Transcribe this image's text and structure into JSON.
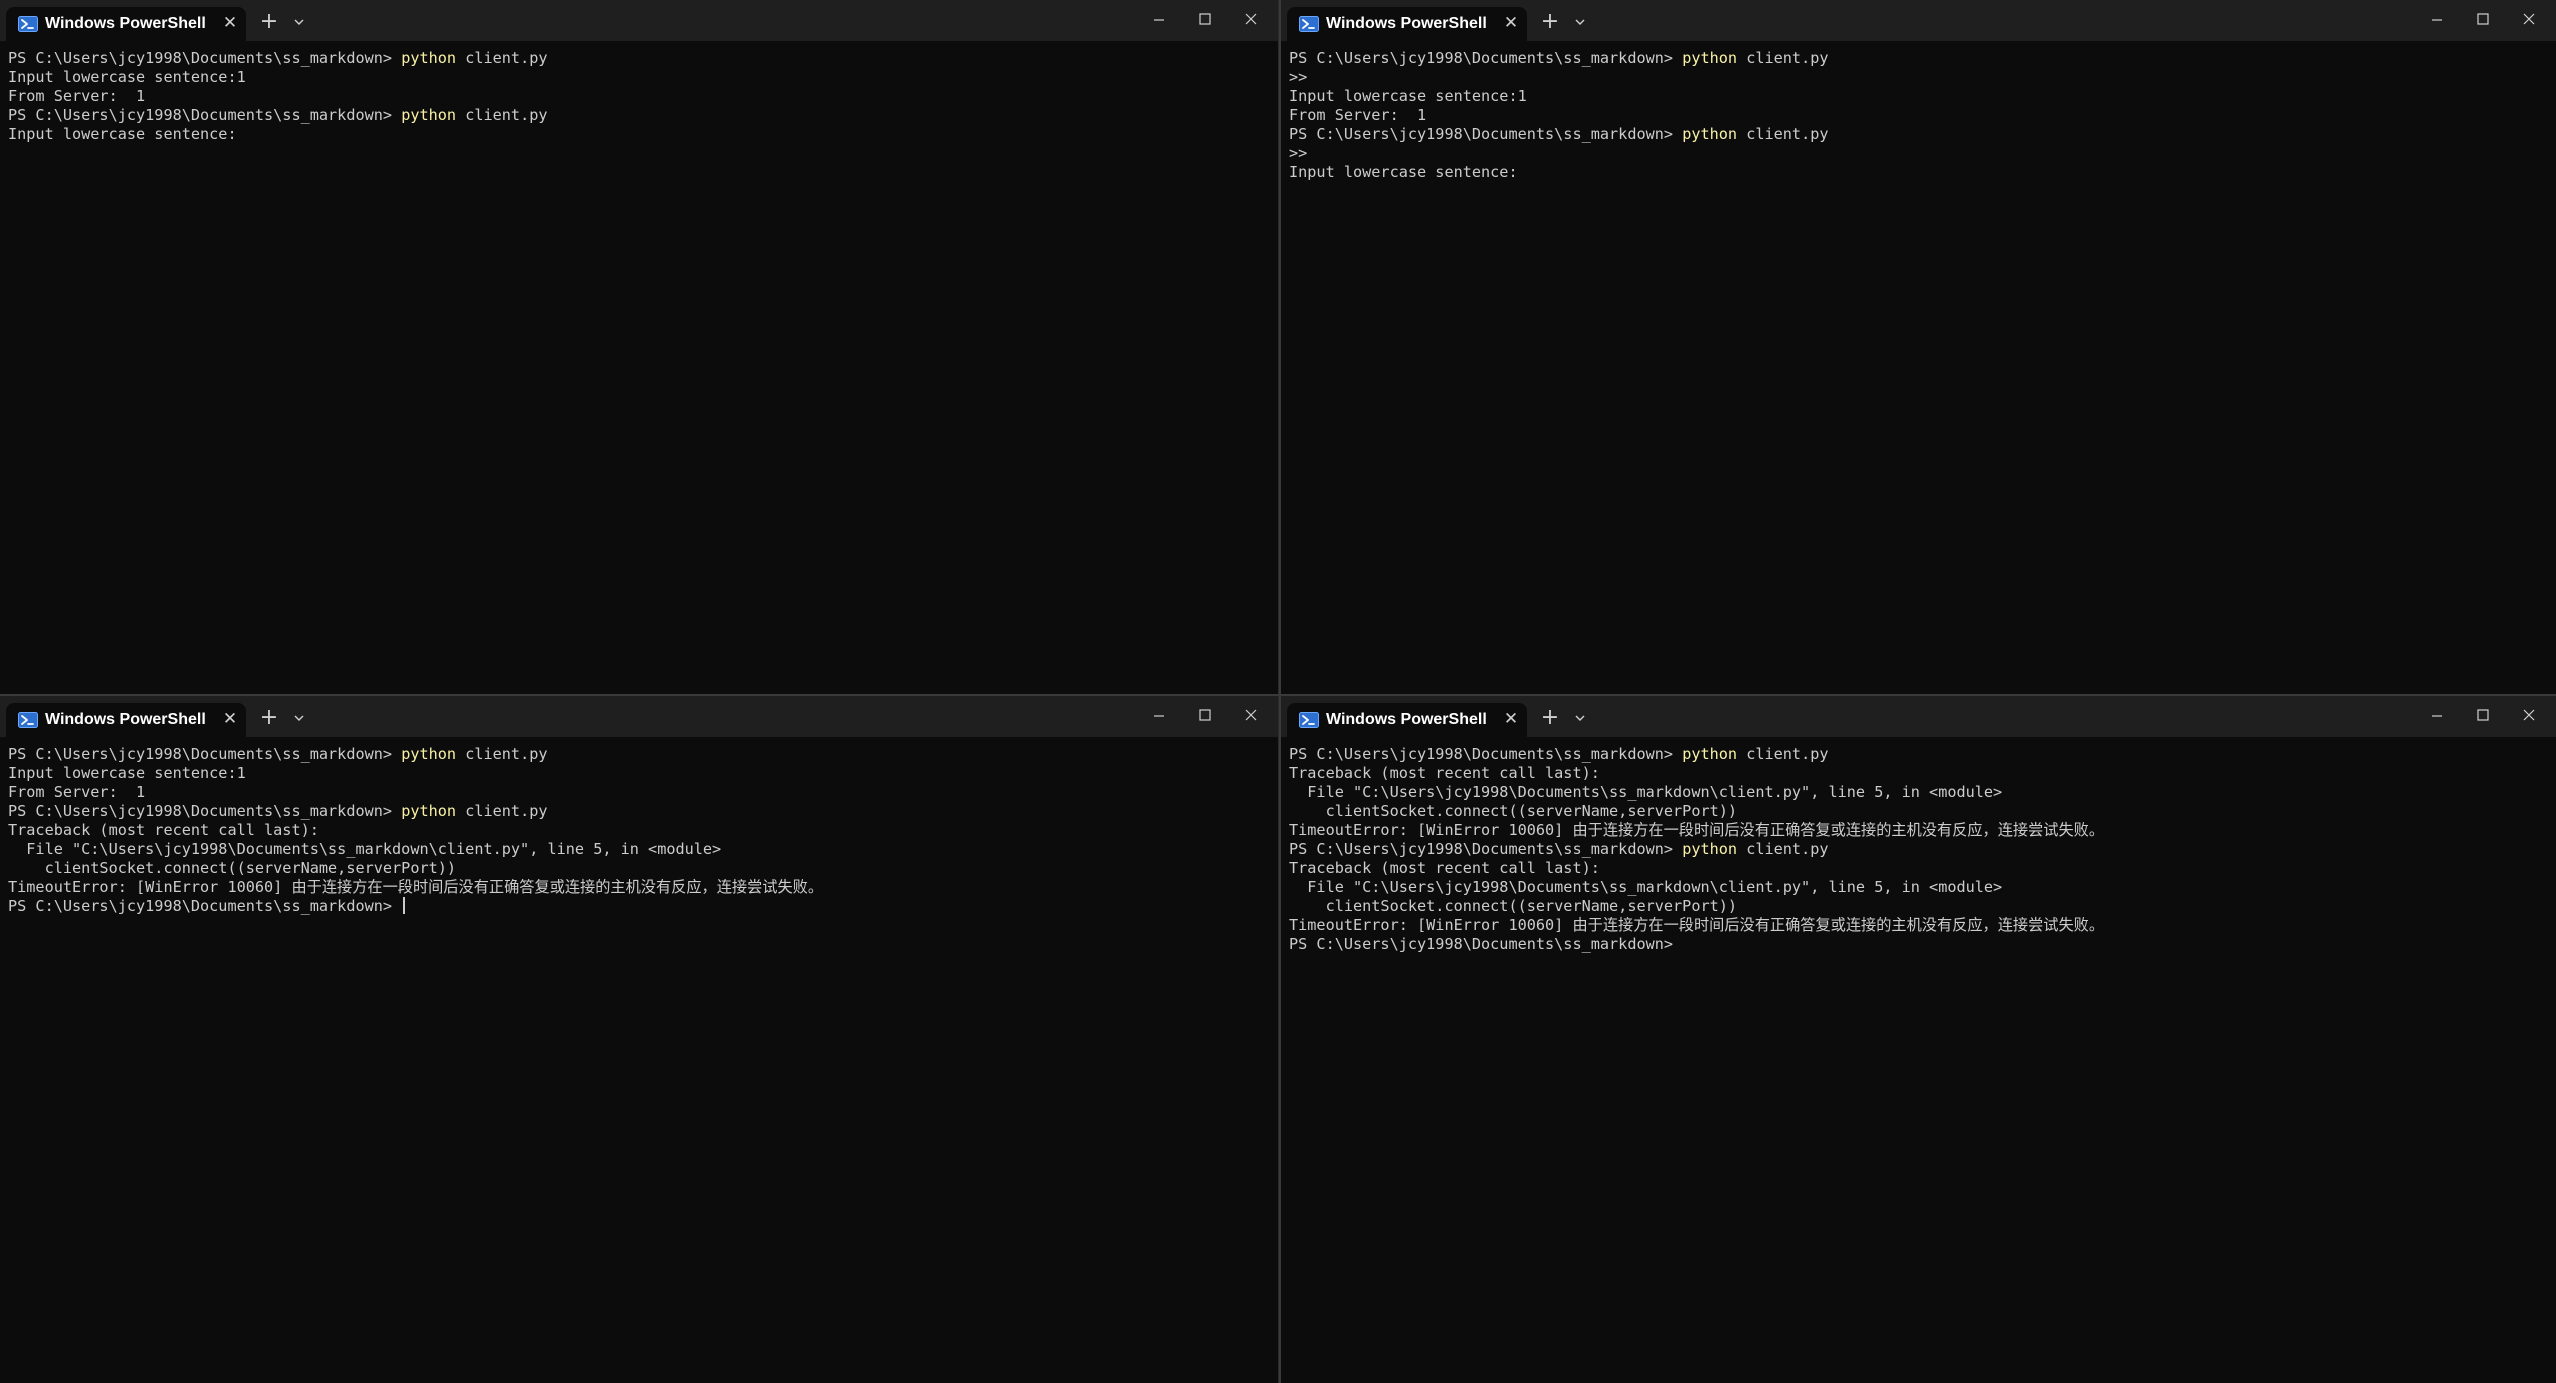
{
  "windows": [
    {
      "title": "Windows PowerShell",
      "lines": [
        {
          "text": "PS C:\\Users\\jcy1998\\Documents\\ss_markdown> ",
          "cmd": "python",
          "rest": " client.py"
        },
        {
          "text": "Input lowercase sentence:1"
        },
        {
          "text": "From Server:  1"
        },
        {
          "text": "PS C:\\Users\\jcy1998\\Documents\\ss_markdown> ",
          "cmd": "python",
          "rest": " client.py"
        },
        {
          "text": "Input lowercase sentence:"
        }
      ]
    },
    {
      "title": "Windows PowerShell",
      "lines": [
        {
          "text": "PS C:\\Users\\jcy1998\\Documents\\ss_markdown> ",
          "cmd": "python",
          "rest": " client.py"
        },
        {
          "text": ">>"
        },
        {
          "text": "Input lowercase sentence:1"
        },
        {
          "text": "From Server:  1"
        },
        {
          "text": "PS C:\\Users\\jcy1998\\Documents\\ss_markdown> ",
          "cmd": "python",
          "rest": " client.py"
        },
        {
          "text": ">>"
        },
        {
          "text": "Input lowercase sentence:"
        }
      ]
    },
    {
      "title": "Windows PowerShell",
      "lines": [
        {
          "text": "PS C:\\Users\\jcy1998\\Documents\\ss_markdown> ",
          "cmd": "python",
          "rest": " client.py"
        },
        {
          "text": "Input lowercase sentence:1"
        },
        {
          "text": "From Server:  1"
        },
        {
          "text": "PS C:\\Users\\jcy1998\\Documents\\ss_markdown> ",
          "cmd": "python",
          "rest": " client.py"
        },
        {
          "text": "Traceback (most recent call last):"
        },
        {
          "text": "  File \"C:\\Users\\jcy1998\\Documents\\ss_markdown\\client.py\", line 5, in <module>"
        },
        {
          "text": "    clientSocket.connect((serverName,serverPort))"
        },
        {
          "text": "TimeoutError: [WinError 10060] 由于连接方在一段时间后没有正确答复或连接的主机没有反应，连接尝试失败。"
        },
        {
          "text": "PS C:\\Users\\jcy1998\\Documents\\ss_markdown> ",
          "cursor": true
        }
      ]
    },
    {
      "title": "Windows PowerShell",
      "lines": [
        {
          "text": "PS C:\\Users\\jcy1998\\Documents\\ss_markdown> ",
          "cmd": "python",
          "rest": " client.py"
        },
        {
          "text": "Traceback (most recent call last):"
        },
        {
          "text": "  File \"C:\\Users\\jcy1998\\Documents\\ss_markdown\\client.py\", line 5, in <module>"
        },
        {
          "text": "    clientSocket.connect((serverName,serverPort))"
        },
        {
          "text": "TimeoutError: [WinError 10060] 由于连接方在一段时间后没有正确答复或连接的主机没有反应，连接尝试失败。"
        },
        {
          "text": "PS C:\\Users\\jcy1998\\Documents\\ss_markdown> ",
          "cmd": "python",
          "rest": " client.py"
        },
        {
          "text": "Traceback (most recent call last):"
        },
        {
          "text": "  File \"C:\\Users\\jcy1998\\Documents\\ss_markdown\\client.py\", line 5, in <module>"
        },
        {
          "text": "    clientSocket.connect((serverName,serverPort))"
        },
        {
          "text": "TimeoutError: [WinError 10060] 由于连接方在一段时间后没有正确答复或连接的主机没有反应，连接尝试失败。"
        },
        {
          "text": "PS C:\\Users\\jcy1998\\Documents\\ss_markdown>"
        }
      ]
    }
  ],
  "icons": {
    "tab_icon": "powershell-icon",
    "close": "close-icon",
    "new_tab": "plus-icon",
    "dropdown": "chevron-down-icon",
    "minimize": "minimize-icon",
    "maximize": "maximize-icon",
    "window_close": "window-close-icon"
  },
  "colors": {
    "background": "#0c0c0c",
    "titlebar": "#1f1f1f",
    "text": "#cccccc",
    "command": "#f9f1a5"
  }
}
